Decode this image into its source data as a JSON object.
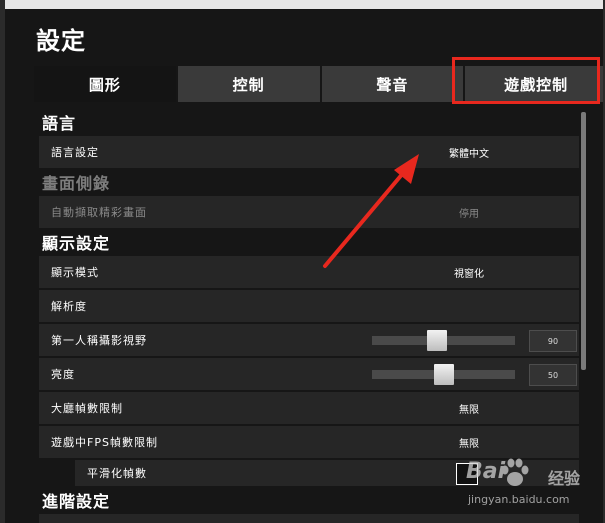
{
  "title": "設定",
  "tabs": [
    {
      "label": "圖形",
      "active": true
    },
    {
      "label": "控制",
      "active": false
    },
    {
      "label": "聲音",
      "active": false
    },
    {
      "label": "遊戲控制",
      "active": false
    }
  ],
  "sections": {
    "language": "語言",
    "capture": "畫面側錄",
    "display": "顯示設定",
    "advanced": "進階設定"
  },
  "rows": {
    "language_setting": {
      "label": "語言設定",
      "value": "繁體中文"
    },
    "auto_capture": {
      "label": "自動擷取精彩畫面",
      "value": "停用"
    },
    "display_mode": {
      "label": "顯示模式",
      "value": "視窗化"
    },
    "resolution": {
      "label": "解析度"
    },
    "fov": {
      "label": "第一人稱攝影視野",
      "value": "90",
      "level": 0.45
    },
    "brightness": {
      "label": "亮度",
      "value": "50",
      "level": 0.5
    },
    "lobby_fps": {
      "label": "大廳幀數限制",
      "value": "無限"
    },
    "game_fps": {
      "label": "遊戲中FPS幀數限制",
      "value": "無限"
    },
    "smooth_fps": {
      "label": "平滑化幀數"
    }
  },
  "watermark": {
    "brand": "Bai",
    "jingyan": "经验",
    "url": "jingyan.baidu.com"
  },
  "colors": {
    "highlight": "#e8281e",
    "arrow": "#e8281e",
    "background": "#161616",
    "row": "#262626"
  }
}
